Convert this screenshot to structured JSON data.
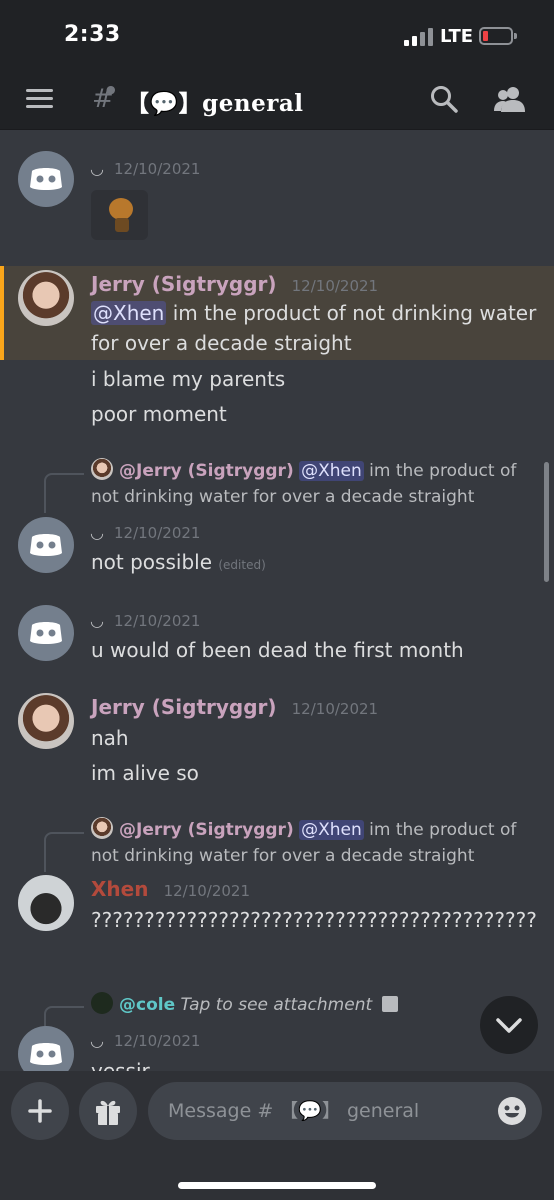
{
  "status_bar": {
    "time": "2:33",
    "network": "LTE"
  },
  "header": {
    "channel_hash": "#",
    "channel_name": "【💬】general",
    "search_icon": "search-icon",
    "members_icon": "members-icon"
  },
  "messages": [
    {
      "author": "",
      "timestamp": "12/10/2021",
      "attachment": "image"
    },
    {
      "author": "Jerry (Sigtryggr)",
      "timestamp": "12/10/2021",
      "mention": "@Xhen",
      "text": " im the product of not drinking water for over a decade straight",
      "followups": [
        "i blame my parents",
        "poor moment"
      ]
    },
    {
      "reply_author": "@Jerry (Sigtryggr)",
      "reply_mention": "@Xhen",
      "reply_text": " im the product of not drinking water for over a decade straight",
      "timestamp": "12/10/2021",
      "text": "not possible",
      "edited": "(edited)"
    },
    {
      "timestamp": "12/10/2021",
      "text": "u would of been dead the first month"
    },
    {
      "author": "Jerry (Sigtryggr)",
      "timestamp": "12/10/2021",
      "text": "nah",
      "followups": [
        "im alive so"
      ]
    },
    {
      "reply_author": "@Jerry (Sigtryggr)",
      "reply_mention": "@Xhen",
      "reply_text": " im the product of not drinking water for over a decade straight",
      "author": "Xhen",
      "timestamp": "12/10/2021",
      "text": "??????????????????????????????????????????"
    },
    {
      "reply_author": "@cole",
      "reply_text": "Tap to see attachment",
      "timestamp": "12/10/2021",
      "text": "yessir"
    }
  ],
  "input": {
    "placeholder": "Message # 【💬】 general"
  },
  "colors": {
    "jerry": "#c9a3bd",
    "xhen": "#b34a3c",
    "cole": "#5fc7c7",
    "highlight": "#faa61a",
    "background": "#36393f"
  }
}
